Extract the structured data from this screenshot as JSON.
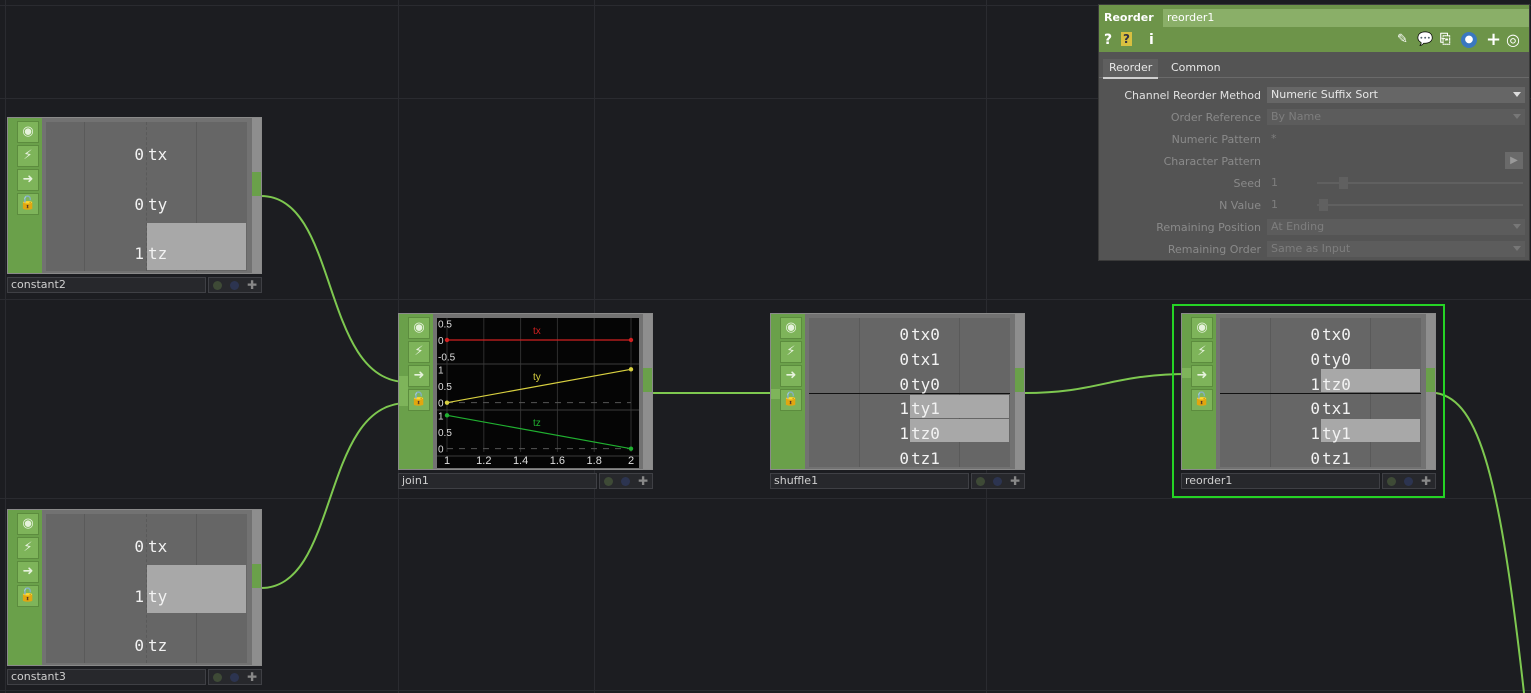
{
  "nodes": {
    "constant2": {
      "label": "constant2",
      "channels": [
        {
          "value": "0",
          "name": "tx"
        },
        {
          "value": "0",
          "name": "ty"
        },
        {
          "value": "1",
          "name": "tz"
        }
      ]
    },
    "constant3": {
      "label": "constant3",
      "channels": [
        {
          "value": "0",
          "name": "tx"
        },
        {
          "value": "1",
          "name": "ty"
        },
        {
          "value": "0",
          "name": "tz"
        }
      ]
    },
    "join1": {
      "label": "join1",
      "graph": {
        "x_ticks": [
          "1",
          "1.2",
          "1.4",
          "1.6",
          "1.8",
          "2"
        ],
        "tracks": [
          {
            "name": "tx",
            "color": "#d02020",
            "y_ticks": [
              "0.5",
              "0",
              "-0.5"
            ],
            "x": [
              1,
              2
            ],
            "y": [
              0,
              0
            ]
          },
          {
            "name": "ty",
            "color": "#d8d040",
            "y_ticks": [
              "1",
              "0.5",
              "0"
            ],
            "x": [
              1,
              2
            ],
            "y": [
              0,
              1
            ]
          },
          {
            "name": "tz",
            "color": "#20b030",
            "y_ticks": [
              "1",
              "0.5",
              "0"
            ],
            "x": [
              1,
              2
            ],
            "y": [
              1,
              0
            ]
          }
        ]
      }
    },
    "shuffle1": {
      "label": "shuffle1",
      "channels": [
        {
          "value": "0",
          "name": "tx0"
        },
        {
          "value": "0",
          "name": "tx1"
        },
        {
          "value": "0",
          "name": "ty0"
        },
        {
          "value": "1",
          "name": "ty1"
        },
        {
          "value": "1",
          "name": "tz0"
        },
        {
          "value": "0",
          "name": "tz1"
        }
      ]
    },
    "reorder1": {
      "label": "reorder1",
      "channels": [
        {
          "value": "0",
          "name": "tx0"
        },
        {
          "value": "0",
          "name": "ty0"
        },
        {
          "value": "1",
          "name": "tz0"
        },
        {
          "value": "0",
          "name": "tx1"
        },
        {
          "value": "1",
          "name": "ty1"
        },
        {
          "value": "0",
          "name": "tz1"
        }
      ]
    }
  },
  "panel": {
    "type": "Reorder",
    "name": "reorder1",
    "icons": [
      "help-icon",
      "python-help-icon",
      "info-icon",
      "pencil-icon",
      "comment-icon",
      "clone-icon",
      "python-icon",
      "add-icon",
      "target-icon"
    ],
    "tabs": [
      {
        "label": "Reorder",
        "active": true
      },
      {
        "label": "Common",
        "active": false
      }
    ],
    "params": [
      {
        "label": "Channel Reorder Method",
        "value": "Numeric Suffix Sort",
        "kind": "dropdown",
        "enabled": true
      },
      {
        "label": "Order Reference",
        "value": "By Name",
        "kind": "dropdown",
        "enabled": false
      },
      {
        "label": "Numeric Pattern",
        "value": "*",
        "kind": "text",
        "enabled": false
      },
      {
        "label": "Character Pattern",
        "value": "",
        "kind": "text-button",
        "enabled": false
      },
      {
        "label": "Seed",
        "value": "1",
        "kind": "slider",
        "enabled": false
      },
      {
        "label": "N Value",
        "value": "1",
        "kind": "slider",
        "enabled": false
      },
      {
        "label": "Remaining Position",
        "value": "At Ending",
        "kind": "dropdown",
        "enabled": false
      },
      {
        "label": "Remaining Order",
        "value": "Same as Input",
        "kind": "dropdown",
        "enabled": false
      }
    ]
  },
  "colors": {
    "background": "#1c1d21",
    "node_green": "#6aa04a",
    "wire": "#7ec850",
    "selection": "#25d325"
  }
}
